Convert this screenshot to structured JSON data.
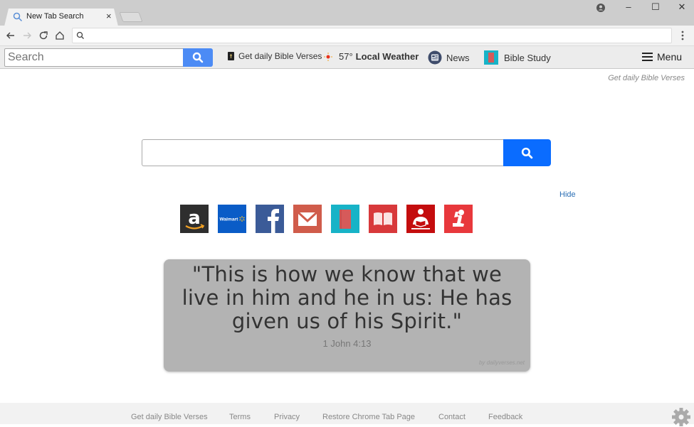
{
  "browser": {
    "tab_title": "New Tab Search",
    "tab_close": "×",
    "window_controls": {
      "account": "account-icon",
      "minimize": "–",
      "maximize": "☐",
      "close": "✕"
    },
    "omnibox": {
      "value": "",
      "icon": "search-icon"
    }
  },
  "extension_bar": {
    "search_placeholder": "Search",
    "links": [
      {
        "label": "Get daily Bible Verses",
        "icon": "bible-book-icon"
      },
      {
        "label_prefix": "57°",
        "label_bold": "Local Weather",
        "icon": "sun-icon"
      },
      {
        "label": "News",
        "icon": "news-icon"
      },
      {
        "label": "Bible Study",
        "icon": "notebook-icon"
      }
    ],
    "menu_label": "Menu"
  },
  "main": {
    "tagline": "Get daily Bible Verses",
    "search_value": "",
    "hide_label": "Hide",
    "tiles": [
      {
        "name": "amazon",
        "bg": "#2e2e2e",
        "label": "a"
      },
      {
        "name": "walmart",
        "bg": "#0a5cc7",
        "label": "Walmart"
      },
      {
        "name": "facebook",
        "bg": "#3b5b98",
        "label": "f"
      },
      {
        "name": "gmail",
        "bg": "#d05c4b"
      },
      {
        "name": "bible-study",
        "bg": "#17b3c7"
      },
      {
        "name": "open-bible",
        "bg": "#d8393b"
      },
      {
        "name": "reading",
        "bg": "#c40d0e"
      },
      {
        "name": "prayer",
        "bg": "#e8383c"
      }
    ],
    "verse": {
      "text": "\"This is how we know that we live in him and he in us: He has given us of his Spirit.\"",
      "reference": "1 John 4:13",
      "credit": "by dailyverses.net"
    }
  },
  "footer": {
    "links": [
      "Get daily Bible Verses",
      "Terms",
      "Privacy",
      "Restore Chrome Tab Page",
      "Contact",
      "Feedback"
    ]
  },
  "colors": {
    "search_blue": "#0a6cff",
    "ext_search_blue": "#4c8bf5",
    "link_blue": "#2b6fb5"
  }
}
